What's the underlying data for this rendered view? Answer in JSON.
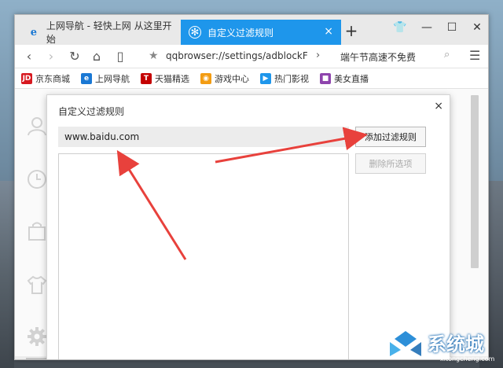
{
  "tabs": [
    {
      "label": "上网导航 - 轻快上网 从这里开始",
      "icon": "ie-icon",
      "active": false
    },
    {
      "label": "自定义过滤规则",
      "icon": "settings-gear-icon",
      "active": true
    }
  ],
  "tab_close_glyph": "×",
  "new_tab_glyph": "+",
  "window_controls": {
    "skin": "👕",
    "minimize": "—",
    "maximize": "☐",
    "close": "✕"
  },
  "nav": {
    "back": "‹",
    "forward": "›",
    "reload": "↻",
    "home": "⌂",
    "reader": "▯",
    "star": "★",
    "url": "qqbrowser://settings/adblockFilters",
    "url_arrow": "›",
    "search_text": "端午节高速不免费",
    "search_glyph": "⌕",
    "menu_glyph": "☰"
  },
  "bookmarks": [
    {
      "label": "京东商城",
      "badge": "JD",
      "color": "#d71920"
    },
    {
      "label": "上网导航",
      "badge": "e",
      "color": "#1a78d4"
    },
    {
      "label": "天猫精选",
      "badge": "T",
      "color": "#c40000"
    },
    {
      "label": "游戏中心",
      "badge": "◉",
      "color": "#f39c12"
    },
    {
      "label": "热门影视",
      "badge": "▶",
      "color": "#1e96eb"
    },
    {
      "label": "美女直播",
      "badge": "■",
      "color": "#8e44ad"
    }
  ],
  "dialog": {
    "title": "自定义过滤规则",
    "close_glyph": "×",
    "input_value": "www.baidu.com",
    "add_button": "添加过滤规则",
    "delete_button": "删除所选项"
  },
  "watermark": {
    "text": "系统城",
    "url": "xitongcheng.com"
  },
  "colors": {
    "accent": "#1e96eb",
    "arrow": "#e8413c"
  }
}
